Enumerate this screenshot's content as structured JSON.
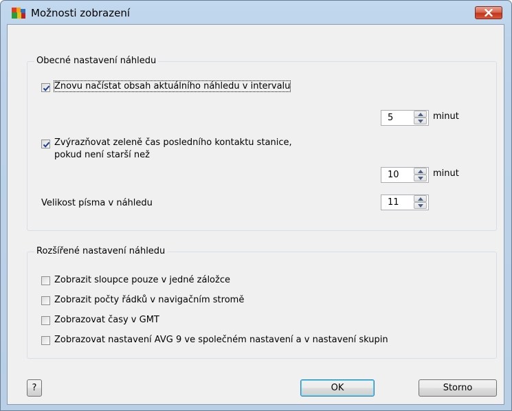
{
  "window": {
    "title": "Možnosti zobrazení"
  },
  "group_general": {
    "legend": "Obecné nastavení náhledu",
    "reload": {
      "label": "Znovu načístat obsah aktuálního náhledu v intervalu",
      "checked": true
    },
    "reload_interval": {
      "value": "5",
      "unit": "minut"
    },
    "highlight": {
      "label_line1": "Zvýrazňovat zeleně čas posledního kontaktu stanice,",
      "label_line2": "pokud není starší než",
      "checked": true
    },
    "highlight_interval": {
      "value": "10",
      "unit": "minut"
    },
    "font_size": {
      "label": "Velikost písma v náhledu",
      "value": "11"
    }
  },
  "group_advanced": {
    "legend": "Rozšířené nastavení náhledu",
    "options": [
      {
        "label": "Zobrazit sloupce pouze v jedné záložce",
        "checked": false
      },
      {
        "label": "Zobrazit počty řádků v navigačním stromě",
        "checked": false
      },
      {
        "label": "Zobrazovat časy v GMT",
        "checked": false
      },
      {
        "label": "Zobrazovat nastavení AVG 9 ve společném nastavení a v nastavení skupin",
        "checked": false
      }
    ]
  },
  "buttons": {
    "help": "?",
    "ok": "OK",
    "cancel": "Storno"
  },
  "icons": {
    "app": "avg-logo-icon",
    "close": "close-icon",
    "check": "checkmark-icon",
    "spin_up": "arrow-up-icon",
    "spin_down": "arrow-down-icon"
  },
  "colors": {
    "title_bar": "#bcd3ea",
    "close_button": "#c9452a",
    "dialog_bg": "#f0f0f0",
    "checkmark": "#1c3f94"
  }
}
